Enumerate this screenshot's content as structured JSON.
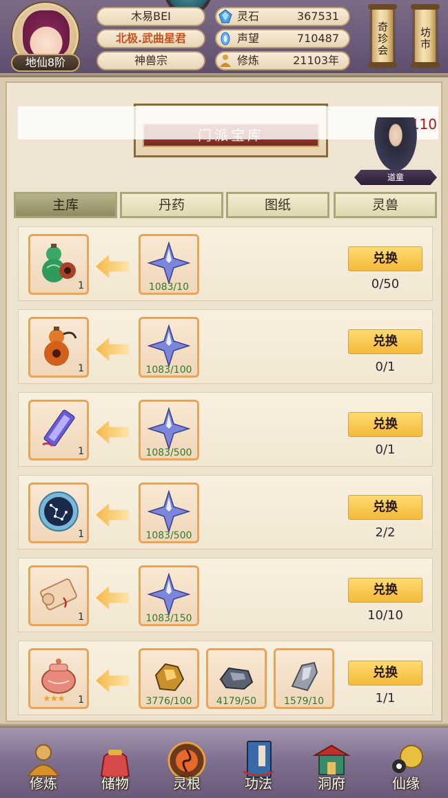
{
  "header": {
    "player_name": "木易BEI",
    "title": "北极.武曲星君",
    "sect": "神兽宗",
    "realm": "地仙8阶",
    "resources": [
      {
        "label": "灵石",
        "value": "367531",
        "icon": "spirit-stone-icon",
        "color": "#4aa0e6"
      },
      {
        "label": "声望",
        "value": "710487",
        "icon": "reputation-icon",
        "color": "#6ab0f0"
      },
      {
        "label": "修炼",
        "value": "21103年",
        "icon": "cultivation-icon",
        "color": "#e0a040"
      }
    ],
    "side_buttons": [
      {
        "label": "奇珍会",
        "icon": "treasure-fair-scroll"
      },
      {
        "label": "坊市",
        "icon": "market-scroll"
      }
    ]
  },
  "panel": {
    "title": "门派宝库",
    "marquee_text": "【2110",
    "npc_name": "道童"
  },
  "tabs": [
    {
      "label": "主库",
      "active": true
    },
    {
      "label": "丹药",
      "active": false
    },
    {
      "label": "图纸",
      "active": false
    },
    {
      "label": "灵兽",
      "active": false
    }
  ],
  "rows": [
    {
      "reward": {
        "icon": "green-gourd-icon",
        "qty": "1"
      },
      "costs": [
        {
          "icon": "blue-crystal-star-icon",
          "amount": "1083/10"
        }
      ],
      "button": "兑换",
      "progress": "0/50"
    },
    {
      "reward": {
        "icon": "orange-gourd-icon",
        "qty": "1"
      },
      "costs": [
        {
          "icon": "blue-crystal-star-icon",
          "amount": "1083/100"
        }
      ],
      "button": "兑换",
      "progress": "0/1"
    },
    {
      "reward": {
        "icon": "talisman-scroll-icon",
        "qty": "1"
      },
      "costs": [
        {
          "icon": "blue-crystal-star-icon",
          "amount": "1083/500"
        }
      ],
      "button": "兑换",
      "progress": "0/1"
    },
    {
      "reward": {
        "icon": "star-chart-disc-icon",
        "qty": "1"
      },
      "costs": [
        {
          "icon": "blue-crystal-star-icon",
          "amount": "1083/500"
        }
      ],
      "button": "兑换",
      "progress": "2/2"
    },
    {
      "reward": {
        "icon": "paper-scroll-icon",
        "qty": "1"
      },
      "costs": [
        {
          "icon": "blue-crystal-star-icon",
          "amount": "1083/150"
        }
      ],
      "button": "兑换",
      "progress": "10/10"
    },
    {
      "reward": {
        "icon": "pink-cauldron-icon",
        "qty": "1",
        "stars": "★★★"
      },
      "costs": [
        {
          "icon": "gold-ore-icon",
          "amount": "3776/100"
        },
        {
          "icon": "dark-iron-ore-icon",
          "amount": "4179/50"
        },
        {
          "icon": "silver-ore-icon",
          "amount": "1579/10"
        }
      ],
      "button": "兑换",
      "progress": "1/1"
    }
  ],
  "nav": [
    {
      "label": "修炼",
      "icon": "meditating-monk-icon"
    },
    {
      "label": "储物",
      "icon": "storage-bag-icon"
    },
    {
      "label": "灵根",
      "icon": "spirit-root-icon"
    },
    {
      "label": "功法",
      "icon": "technique-book-icon"
    },
    {
      "label": "洞府",
      "icon": "cave-mansion-icon"
    },
    {
      "label": "仙缘",
      "icon": "immortal-fate-icon"
    }
  ]
}
